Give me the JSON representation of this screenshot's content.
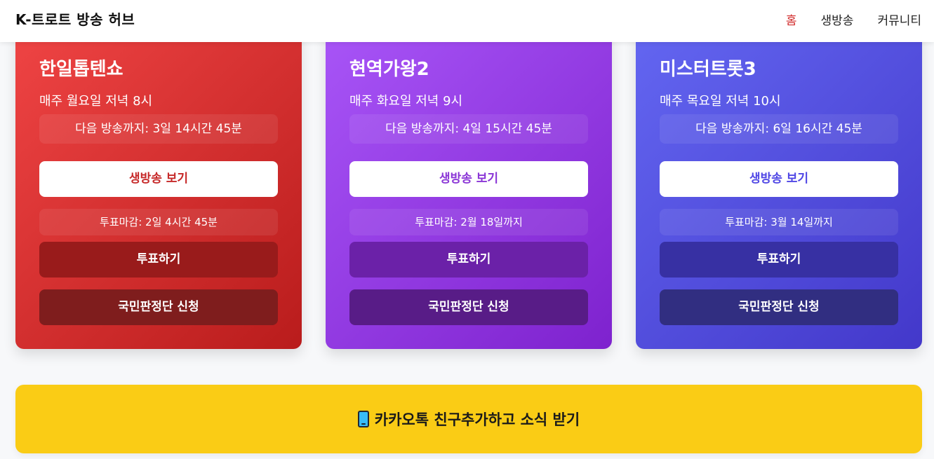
{
  "header": {
    "brand": "K-트로트 방송 허브",
    "nav": [
      {
        "label": "홈",
        "active": true
      },
      {
        "label": "생방송",
        "active": false
      },
      {
        "label": "커뮤니티",
        "active": false
      }
    ]
  },
  "shows": [
    {
      "title": "한일톱텐쇼",
      "schedule": "매주 월요일 저녁 8시",
      "countdown": "다음 방송까지: 3일 14시간 45분",
      "live_label": "생방송 보기",
      "vote_deadline": "투표마감: 2일 4시간 45분",
      "vote_label": "투표하기",
      "jury_label": "국민판정단 신청"
    },
    {
      "title": "현역가왕2",
      "schedule": "매주 화요일 저녁 9시",
      "countdown": "다음 방송까지: 4일 15시간 45분",
      "live_label": "생방송 보기",
      "vote_deadline": "투표마감: 2월 18일까지",
      "vote_label": "투표하기",
      "jury_label": "국민판정단 신청"
    },
    {
      "title": "미스터트롯3",
      "schedule": "매주 목요일 저녁 10시",
      "countdown": "다음 방송까지: 6일 16시간 45분",
      "live_label": "생방송 보기",
      "vote_deadline": "투표마감: 3월 14일까지",
      "vote_label": "투표하기",
      "jury_label": "국민판정단 신청"
    }
  ],
  "kakao": {
    "icon": "mobile-phone-icon",
    "label": "카카오톡 친구추가하고 소식 받기",
    "color": "#facc15"
  },
  "colors": {
    "show_1": "#dc2626",
    "show_2": "#9333ea",
    "show_3": "#4f46e5",
    "nav_active": "#d12b2b"
  }
}
